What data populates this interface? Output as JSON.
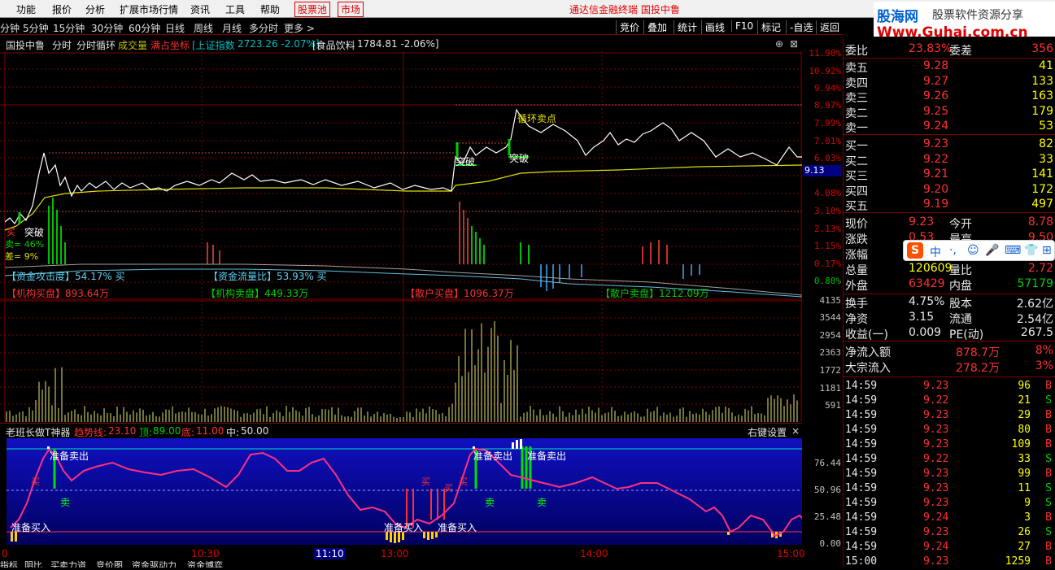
{
  "menu": {
    "items": [
      "功能",
      "报价",
      "分析",
      "扩展市场行情",
      "资讯",
      "工具",
      "帮助"
    ],
    "boxed": [
      "股票池",
      "市场"
    ],
    "broker": "通达信金融终端 国投中鲁"
  },
  "logo": {
    "line1a": "股海网",
    "line1b": "股票软件资源分享",
    "line2": "Www.Guhai.com.cn"
  },
  "toolbar": {
    "periods": [
      "分钟",
      "5分钟",
      "15分钟",
      "30分钟",
      "60分钟",
      "日线",
      "周线",
      "月线",
      "多分时",
      "更多 >"
    ],
    "right": [
      "竞价",
      "叠加",
      "统计",
      "画线",
      "F10",
      "标记",
      "-自选",
      "返回"
    ]
  },
  "chart_title": {
    "stock": "国投中鲁",
    "mode1": "分时",
    "mode2": "分时循环",
    "vol": "成交量",
    "coord": "满占坐标",
    "index": "[上证指数",
    "index_val": "2723.26 -2.07%]",
    "sector": "[食品饮料",
    "sector_val": "1784.81 -2.06%]"
  },
  "axis": {
    "pct_red": [
      "11.90%",
      "10.92%",
      "9.94%",
      "8.97%",
      "7.99%",
      "7.01%",
      "6.03%",
      "5.05%",
      "4.08%",
      "3.10%",
      "2.13%",
      "1.15%",
      "0.17%"
    ],
    "pct_green": "0.80%",
    "current_price": "9.13",
    "vol": [
      "4135",
      "3544",
      "2954",
      "2363",
      "1772",
      "1181",
      "591"
    ],
    "ind": [
      "76.44",
      "50.96",
      "25.48",
      "0.00"
    ]
  },
  "price_annotations": {
    "break1": "突破",
    "break2": "突破",
    "break3": "突破",
    "cycle_sell": "循环卖点",
    "sell_ratio": "卖= 46%",
    "diff": "差= 9%",
    "buy_label": "买"
  },
  "fund_labels": {
    "attack": "【资金攻击度】54.17% 买",
    "flow": "【资金流量比】53.93% 买",
    "inst_buy": "【机构买盘】",
    "inst_buy_v": "893.64万",
    "inst_sell": "【机构卖盘】",
    "inst_sell_v": "449.33万",
    "retail_buy": "【散户买盘】",
    "retail_buy_v": "1096.37万",
    "retail_sell": "【散户卖盘】",
    "retail_sell_v": "1212.09万"
  },
  "indicator": {
    "name": "老班长做T神器",
    "trend_label": "趋势线:",
    "trend_v": "23.10",
    "top_label": "顶:",
    "top_v": "89.00",
    "bottom_label": "底:",
    "bottom_v": "11.00",
    "mid_label": "中:",
    "mid_v": "50.00",
    "settings": "右键设置",
    "close": "×"
  },
  "ind_labels": {
    "prep_sell1": "准备卖出",
    "prep_sell2": "准备卖出",
    "prep_sell3": "准备卖出",
    "prep_buy1": "准备买入",
    "prep_buy2": "准备买入",
    "prep_buy3": "准备买入",
    "sell1": "卖",
    "sell2": "卖",
    "sell3": "卖",
    "buy1": "买",
    "buy2": "买",
    "buy3": "买",
    "buy4": "买"
  },
  "time_axis": {
    "t1": "10:30",
    "t2": "11:10",
    "t3": "13:00",
    "t4": "14:00",
    "t5": "15:00",
    "t0": "0"
  },
  "bottom_tabs": [
    "指标",
    "阴比",
    "买卖力道",
    "竞价图",
    "资金驱动力",
    "资金博弈"
  ],
  "side": {
    "wei": {
      "l": "委比",
      "v": "23.83%",
      "l2": "委差",
      "v2": "356"
    },
    "asks": [
      {
        "l": "卖五",
        "p": "9.28",
        "q": "41"
      },
      {
        "l": "卖四",
        "p": "9.27",
        "q": "133"
      },
      {
        "l": "卖三",
        "p": "9.26",
        "q": "163"
      },
      {
        "l": "卖二",
        "p": "9.25",
        "q": "179"
      },
      {
        "l": "卖一",
        "p": "9.24",
        "q": "53"
      }
    ],
    "bids": [
      {
        "l": "买一",
        "p": "9.23",
        "q": "82"
      },
      {
        "l": "买二",
        "p": "9.22",
        "q": "33"
      },
      {
        "l": "买三",
        "p": "9.21",
        "q": "141"
      },
      {
        "l": "买四",
        "p": "9.20",
        "q": "172"
      },
      {
        "l": "买五",
        "p": "9.19",
        "q": "497"
      }
    ],
    "stats": [
      {
        "l": "现价",
        "v": "9.23",
        "l2": "今开",
        "v2": "8.78"
      },
      {
        "l": "涨跌",
        "v": "0.53",
        "l2": "最高",
        "v2": "9.50"
      },
      {
        "l": "涨幅",
        "v": "",
        "l2": "",
        "v2": ""
      },
      {
        "l": "总量",
        "v": "120609",
        "l2": "量比",
        "v2": "2.72"
      },
      {
        "l": "外盘",
        "v": "63429",
        "l2": "内盘",
        "v2": "57179"
      }
    ],
    "stats2": [
      {
        "l": "换手",
        "v": "4.75%",
        "l2": "股本",
        "v2": "2.62亿"
      },
      {
        "l": "净资",
        "v": "3.15",
        "l2": "流通",
        "v2": "2.54亿"
      },
      {
        "l": "收益(一)",
        "v": "0.009",
        "l2": "PE(动)",
        "v2": "267.5"
      }
    ],
    "flow": [
      {
        "l": "净流入额",
        "v": "878.7万",
        "p": "8%"
      },
      {
        "l": "大宗流入",
        "v": "278.2万",
        "p": "3%"
      }
    ],
    "ticks": [
      {
        "t": "14:59",
        "p": "9.23",
        "v": "96",
        "d": "B"
      },
      {
        "t": "14:59",
        "p": "9.22",
        "v": "21",
        "d": "S"
      },
      {
        "t": "14:59",
        "p": "9.23",
        "v": "29",
        "d": "B"
      },
      {
        "t": "14:59",
        "p": "9.23",
        "v": "80",
        "d": "B"
      },
      {
        "t": "14:59",
        "p": "9.23",
        "v": "109",
        "d": "B"
      },
      {
        "t": "14:59",
        "p": "9.22",
        "v": "33",
        "d": "S"
      },
      {
        "t": "14:59",
        "p": "9.23",
        "v": "99",
        "d": "B"
      },
      {
        "t": "14:59",
        "p": "9.23",
        "v": "11",
        "d": "S"
      },
      {
        "t": "14:59",
        "p": "9.23",
        "v": "9",
        "d": "S"
      },
      {
        "t": "14:59",
        "p": "9.24",
        "v": "3",
        "d": "B"
      },
      {
        "t": "14:59",
        "p": "9.23",
        "v": "26",
        "d": "S"
      },
      {
        "t": "14:59",
        "p": "9.24",
        "v": "27",
        "d": "B"
      },
      {
        "t": "15:00",
        "p": "9.23",
        "v": "1259",
        "d": "B"
      }
    ]
  },
  "ime": {
    "s": "S",
    "items": [
      "中",
      "·,",
      "☺",
      "🎤",
      "⌨",
      "👕",
      "⊞"
    ]
  }
}
